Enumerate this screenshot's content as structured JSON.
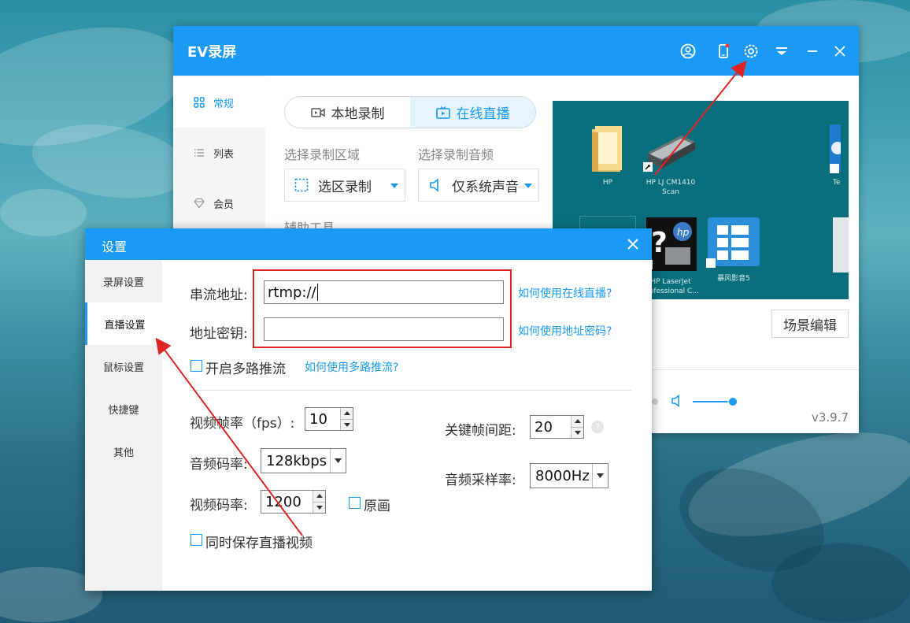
{
  "main_window": {
    "title": "EV录屏",
    "sidebar": [
      {
        "label": "常规",
        "icon": "grid-icon",
        "active": true
      },
      {
        "label": "列表",
        "icon": "list-icon",
        "active": false
      },
      {
        "label": "会员",
        "icon": "diamond-icon",
        "active": false
      }
    ],
    "mode_tabs": [
      {
        "label": "本地录制",
        "icon": "video-icon",
        "active": false
      },
      {
        "label": "在线直播",
        "icon": "live-tv-icon",
        "active": true
      }
    ],
    "region_label": "选择录制区域",
    "region_value": "选区录制",
    "audio_label": "选择录制音频",
    "audio_value": "仅系统声音",
    "aux_tools_label": "辅助工具",
    "preview_icons": [
      {
        "label": "HP"
      },
      {
        "label": "HP LJ CM1410 Scan"
      },
      {
        "label": "HP LaserJet Professional C..."
      },
      {
        "label": "暴风影音5"
      },
      {
        "label": "Te"
      }
    ],
    "scene_edit_button": "场景编辑",
    "volume_level": 0.85,
    "version": "v3.9.7"
  },
  "settings_dialog": {
    "title": "设置",
    "sidebar": [
      {
        "label": "录屏设置",
        "active": false
      },
      {
        "label": "直播设置",
        "active": true
      },
      {
        "label": "鼠标设置",
        "active": false
      },
      {
        "label": "快捷键",
        "active": false
      },
      {
        "label": "其他",
        "active": false
      }
    ],
    "stream_url_label": "串流地址:",
    "stream_url_value": "rtmp://",
    "stream_key_label": "地址密钥:",
    "stream_key_value": "",
    "help_live_link": "如何使用在线直播?",
    "help_key_link": "如何使用地址密码?",
    "multi_push_label": "开启多路推流",
    "multi_push_checked": false,
    "help_multi_link": "如何使用多路推流?",
    "fps_label": "视频帧率（fps）:",
    "fps_value": "10",
    "keyframe_label": "关键帧间距:",
    "keyframe_value": "20",
    "audio_bitrate_label": "音频码率:",
    "audio_bitrate_value": "128kbps",
    "sample_rate_label": "音频采样率:",
    "sample_rate_value": "8000Hz",
    "video_bitrate_label": "视频码率:",
    "video_bitrate_value": "1200",
    "original_label": "原画",
    "original_checked": false,
    "save_video_label": "同时保存直播视频",
    "save_video_checked": false
  },
  "annotation_color": "#e02424",
  "accent_color": "#1a9af5"
}
